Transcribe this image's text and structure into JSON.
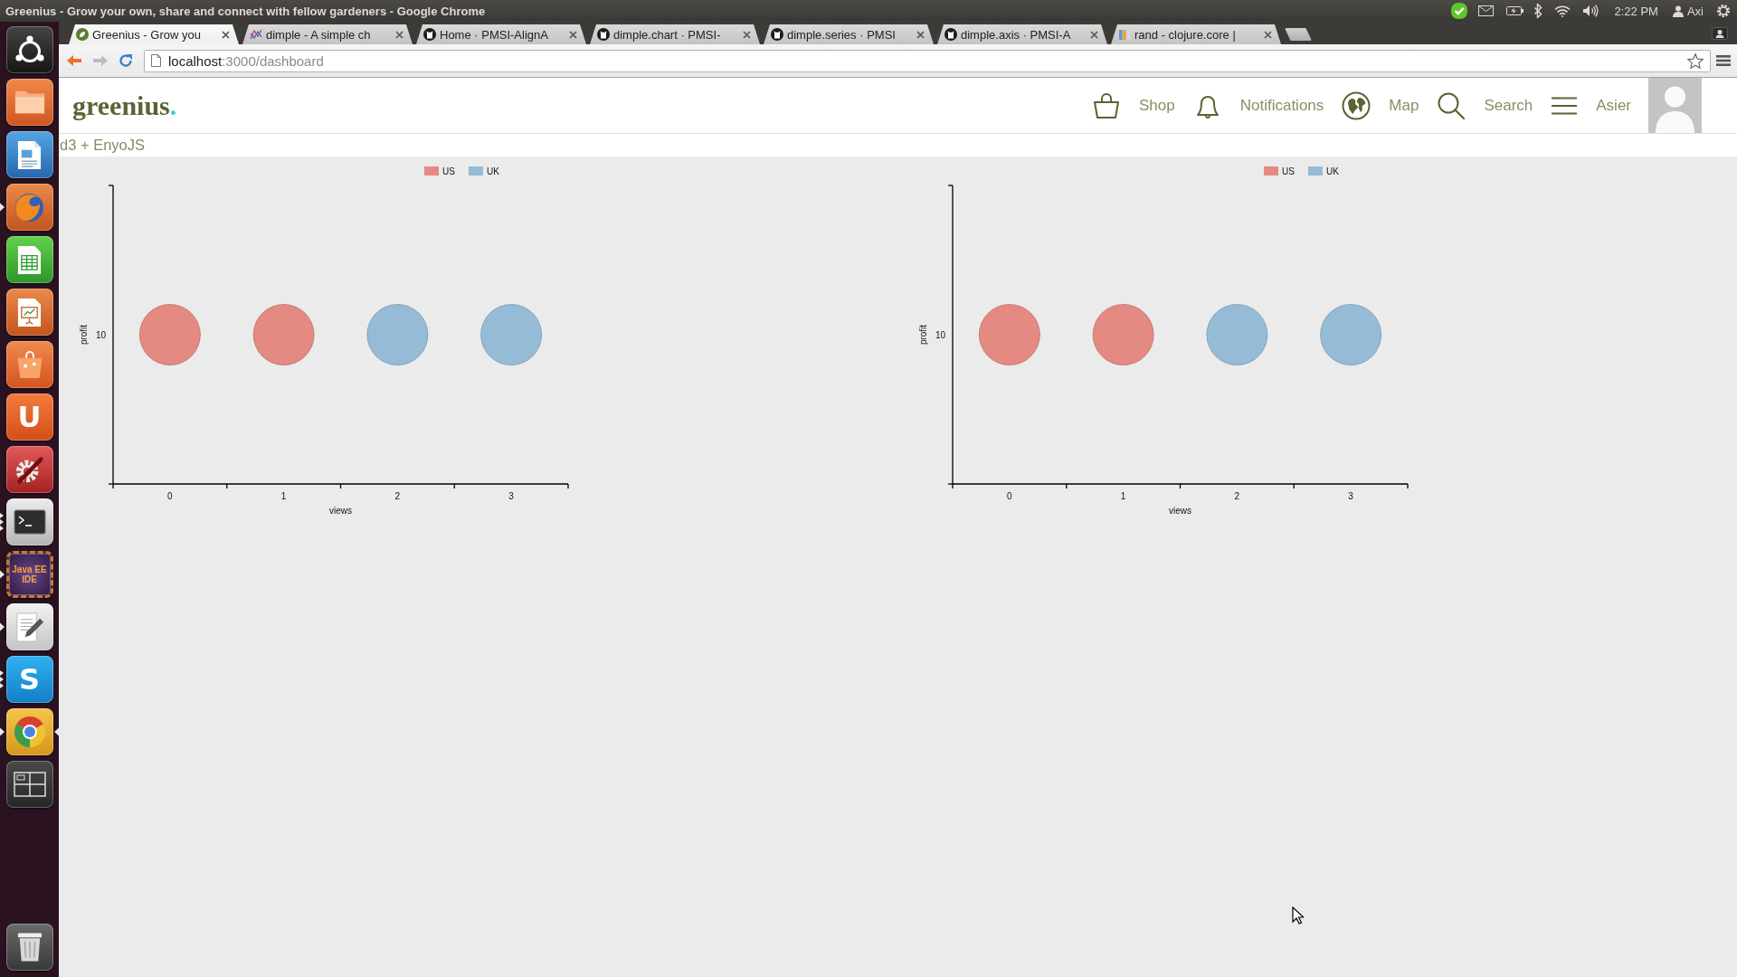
{
  "top_panel": {
    "title": "Greenius - Grow your own, share and connect with fellow gardeners - Google Chrome",
    "clock": "2:22 PM",
    "user": "Axi"
  },
  "launcher": {
    "items": [
      {
        "kind": "dash",
        "running": false,
        "multiple": false,
        "focused": false
      },
      {
        "kind": "folder",
        "running": false,
        "multiple": false,
        "focused": false
      },
      {
        "kind": "document",
        "running": false,
        "multiple": false,
        "focused": false
      },
      {
        "kind": "globe",
        "running": true,
        "multiple": false,
        "focused": false
      },
      {
        "kind": "spreadsheet",
        "running": false,
        "multiple": false,
        "focused": false
      },
      {
        "kind": "presentation",
        "running": false,
        "multiple": false,
        "focused": false
      },
      {
        "kind": "bag",
        "running": false,
        "multiple": false,
        "focused": false
      },
      {
        "kind": "letter",
        "label": "U",
        "running": false,
        "multiple": false,
        "focused": false
      },
      {
        "kind": "tools",
        "running": false,
        "multiple": false,
        "focused": false
      },
      {
        "kind": "terminal",
        "running": true,
        "multiple": true,
        "focused": false
      },
      {
        "kind": "badge",
        "label": "Java EE IDE",
        "running": true,
        "multiple": false,
        "focused": false
      },
      {
        "kind": "editor",
        "running": true,
        "multiple": false,
        "focused": false
      },
      {
        "kind": "chat",
        "label": "S",
        "running": true,
        "multiple": true,
        "focused": false
      },
      {
        "kind": "wheel",
        "running": true,
        "multiple": false,
        "focused": true
      },
      {
        "kind": "workspaces",
        "running": false,
        "multiple": false,
        "focused": false
      }
    ],
    "bottom_items": [
      {
        "kind": "trash",
        "running": false,
        "multiple": false,
        "focused": false
      }
    ]
  },
  "tabs": [
    {
      "title": "Greenius - Grow you",
      "kind": "leaf",
      "selected": true
    },
    {
      "title": "dimple - A simple ch",
      "kind": "lines",
      "selected": false
    },
    {
      "title": "Home · PMSI-AlignA",
      "kind": "cat",
      "selected": false
    },
    {
      "title": "dimple.chart · PMSI-",
      "kind": "cat",
      "selected": false
    },
    {
      "title": "dimple.series · PMSI",
      "kind": "cat",
      "selected": false
    },
    {
      "title": "dimple.axis · PMSI-A",
      "kind": "cat",
      "selected": false
    },
    {
      "title": "rand - clojure.core |",
      "kind": "bars",
      "selected": false
    }
  ],
  "toolbar": {
    "nav_buttons": [
      {
        "kind": "back",
        "disabled": false
      },
      {
        "kind": "forward",
        "disabled": true
      },
      {
        "kind": "reload",
        "disabled": false
      }
    ],
    "address": {
      "host": "localhost",
      "path": ":3000/dashboard"
    }
  },
  "site_header": {
    "logo": {
      "name": "greenius",
      "dot": "."
    },
    "nav": [
      {
        "kind": "basket",
        "label": "Shop"
      },
      {
        "kind": "bell",
        "label": "Notifications"
      },
      {
        "kind": "globe",
        "label": "Map"
      },
      {
        "kind": "magnifier",
        "label": "Search"
      },
      {
        "kind": "menu",
        "label": "Asier"
      }
    ]
  },
  "subtitle": "d3 + EnyoJS",
  "charts": [
    {
      "legend": [
        {
          "label": "US",
          "color": "#e48a83"
        },
        {
          "label": "UK",
          "color": "#95bbd7"
        }
      ],
      "y_axis": {
        "title": "profit",
        "tick_labels": [
          "10"
        ]
      },
      "x_axis": {
        "title": "views",
        "tick_labels": [
          "0",
          "1",
          "2",
          "3"
        ]
      },
      "points": [
        {
          "color": "#e48a83"
        },
        {
          "color": "#e48a83"
        },
        {
          "color": "#95bbd7"
        },
        {
          "color": "#95bbd7"
        }
      ]
    },
    {
      "legend": [
        {
          "label": "US",
          "color": "#e48a83"
        },
        {
          "label": "UK",
          "color": "#95bbd7"
        }
      ],
      "y_axis": {
        "title": "profit",
        "tick_labels": [
          "10"
        ]
      },
      "x_axis": {
        "title": "views",
        "tick_labels": [
          "0",
          "1",
          "2",
          "3"
        ]
      },
      "points": [
        {
          "color": "#e48a83"
        },
        {
          "color": "#e48a83"
        },
        {
          "color": "#95bbd7"
        },
        {
          "color": "#95bbd7"
        }
      ]
    }
  ]
}
